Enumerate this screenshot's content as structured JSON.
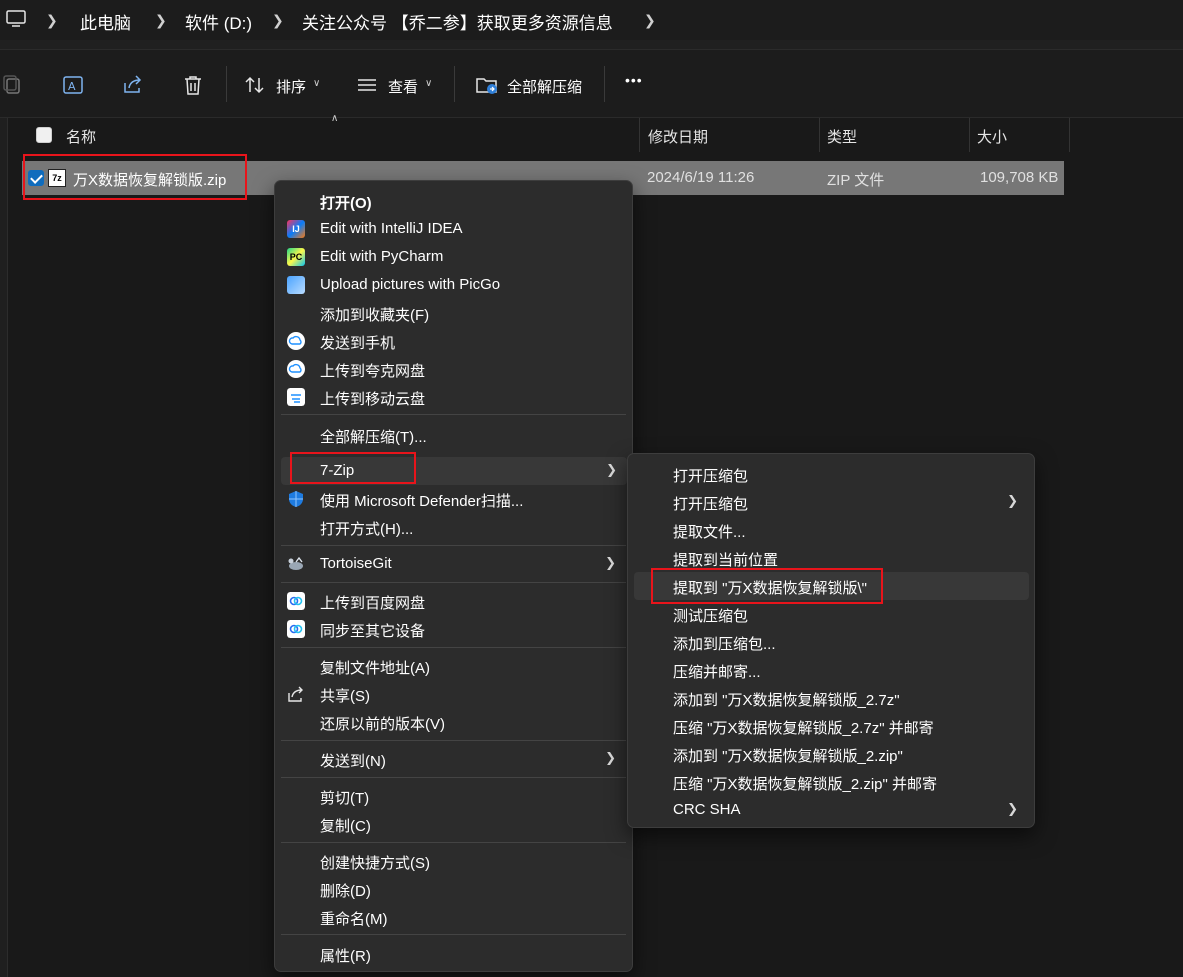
{
  "breadcrumb": {
    "items": [
      "此电脑",
      "软件 (D:)",
      "关注公众号 【乔二参】获取更多资源信息"
    ]
  },
  "toolbar": {
    "sort_label": "排序",
    "view_label": "查看",
    "extract_all_label": "全部解压缩",
    "more_label": "•••"
  },
  "columns": {
    "name": "名称",
    "modified": "修改日期",
    "type": "类型",
    "size": "大小"
  },
  "file": {
    "icon_text": "7z",
    "name": "万X数据恢复解锁版.zip",
    "modified": "2024/6/19 11:26",
    "type": "ZIP 文件",
    "size": "109,708 KB"
  },
  "context_menu": {
    "items": [
      "打开(O)",
      "Edit with IntelliJ IDEA",
      "Edit with PyCharm",
      "Upload pictures with PicGo",
      "添加到收藏夹(F)",
      "发送到手机",
      "上传到夸克网盘",
      "上传到移动云盘",
      "全部解压缩(T)...",
      "7-Zip",
      "使用 Microsoft Defender扫描...",
      "打开方式(H)...",
      "TortoiseGit",
      "上传到百度网盘",
      "同步至其它设备",
      "复制文件地址(A)",
      "共享(S)",
      "还原以前的版本(V)",
      "发送到(N)",
      "剪切(T)",
      "复制(C)",
      "创建快捷方式(S)",
      "删除(D)",
      "重命名(M)",
      "属性(R)"
    ],
    "icon_names": {
      "intellij": "IJ",
      "pycharm": "PC",
      "baidu_color": "#2b6cf0",
      "cloud_color": "#1e90ff"
    }
  },
  "submenu_7zip": {
    "items": [
      "打开压缩包",
      "打开压缩包",
      "提取文件...",
      "提取到当前位置",
      "提取到 \"万X数据恢复解锁版\\\"",
      "测试压缩包",
      "添加到压缩包...",
      "压缩并邮寄...",
      "添加到 \"万X数据恢复解锁版_2.7z\"",
      "压缩 \"万X数据恢复解锁版_2.7z\" 并邮寄",
      "添加到 \"万X数据恢复解锁版_2.zip\"",
      "压缩 \"万X数据恢复解锁版_2.zip\" 并邮寄",
      "CRC SHA"
    ]
  },
  "colors": {
    "highlight_red": "#e8141b",
    "selection_gray": "#777777",
    "accent_blue": "#0f6cbd"
  }
}
